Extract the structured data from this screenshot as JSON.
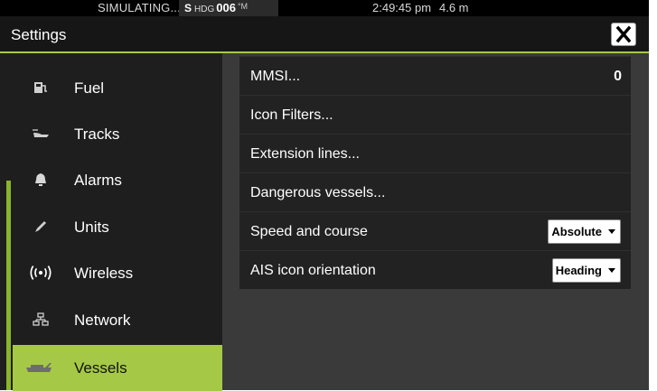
{
  "status_bar": {
    "mode": "SIMULATING...",
    "heading_prefix": "S",
    "heading_label": "HDG",
    "heading_value": "006",
    "heading_unit": "°M",
    "time": "2:49:45 pm",
    "depth": "4.6 m"
  },
  "window": {
    "title": "Settings",
    "close_icon": "close-x-icon"
  },
  "nav": {
    "items": [
      {
        "label": "Fuel",
        "icon": "fuel-pump-icon"
      },
      {
        "label": "Tracks",
        "icon": "track-trail-icon"
      },
      {
        "label": "Alarms",
        "icon": "bell-icon"
      },
      {
        "label": "Units",
        "icon": "pencil-icon"
      },
      {
        "label": "Wireless",
        "icon": "wireless-icon"
      },
      {
        "label": "Network",
        "icon": "network-icon"
      },
      {
        "label": "Vessels",
        "icon": "vessel-icon",
        "selected": true
      }
    ]
  },
  "vessels": {
    "mmsi_label": "MMSI...",
    "mmsi_value": "0",
    "icon_filters_label": "Icon Filters...",
    "extension_lines_label": "Extension lines...",
    "dangerous_vessels_label": "Dangerous vessels...",
    "speed_course_label": "Speed and course",
    "speed_course_value": "Absolute",
    "ais_orientation_label": "AIS icon orientation",
    "ais_orientation_value": "Heading"
  },
  "colors": {
    "accent": "#a5c947",
    "background": "#000000",
    "panel": "#3a3a3a",
    "row": "#222222"
  }
}
